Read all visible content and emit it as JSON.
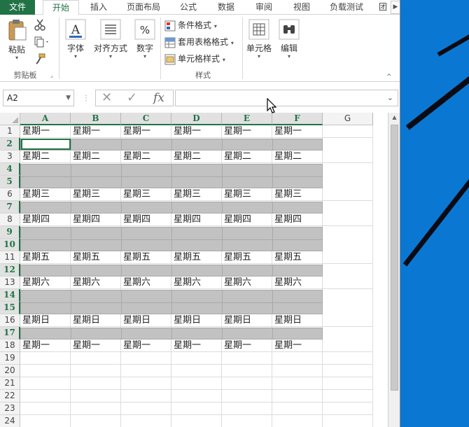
{
  "ribbon": {
    "tabs": [
      {
        "label": "文件",
        "type": "file"
      },
      {
        "label": "开始",
        "type": "active"
      },
      {
        "label": "插入",
        "type": "normal"
      },
      {
        "label": "页面布局",
        "type": "normal"
      },
      {
        "label": "公式",
        "type": "normal"
      },
      {
        "label": "数据",
        "type": "normal"
      },
      {
        "label": "审阅",
        "type": "normal"
      },
      {
        "label": "视图",
        "type": "normal"
      },
      {
        "label": "负载测试",
        "type": "normal"
      },
      {
        "label": "团",
        "type": "normal"
      }
    ],
    "clipboard": {
      "paste_label": "粘贴",
      "group_label": "剪贴板"
    },
    "font": {
      "label": "字体"
    },
    "alignment": {
      "label": "对齐方式"
    },
    "number": {
      "label": "数字"
    },
    "styles": {
      "conditional_label": "条件格式",
      "table_label": "套用表格格式",
      "cell_style_label": "单元格样式",
      "group_label": "样式"
    },
    "cells": {
      "label": "单元格"
    },
    "editing": {
      "label": "编辑"
    }
  },
  "formula_bar": {
    "name_box": "A2",
    "fx_label": "fx",
    "value": ""
  },
  "sheet": {
    "columns": [
      "A",
      "B",
      "C",
      "D",
      "E",
      "F",
      "G"
    ],
    "selected_columns": [
      "A",
      "B",
      "C",
      "D",
      "E",
      "F"
    ],
    "rows": [
      {
        "num": "1",
        "selected": false,
        "cells": [
          "星期一",
          "星期一",
          "星期一",
          "星期一",
          "星期一",
          "星期一"
        ]
      },
      {
        "num": "2",
        "selected": true,
        "cells": []
      },
      {
        "num": "3",
        "selected": false,
        "cells": [
          "星期二",
          "星期二",
          "星期二",
          "星期二",
          "星期二",
          "星期二"
        ]
      },
      {
        "num": "4",
        "selected": true,
        "cells": []
      },
      {
        "num": "5",
        "selected": true,
        "cells": []
      },
      {
        "num": "6",
        "selected": false,
        "cells": [
          "星期三",
          "星期三",
          "星期三",
          "星期三",
          "星期三",
          "星期三"
        ]
      },
      {
        "num": "7",
        "selected": true,
        "cells": []
      },
      {
        "num": "8",
        "selected": false,
        "cells": [
          "星期四",
          "星期四",
          "星期四",
          "星期四",
          "星期四",
          "星期四"
        ]
      },
      {
        "num": "9",
        "selected": true,
        "cells": []
      },
      {
        "num": "10",
        "selected": true,
        "cells": []
      },
      {
        "num": "11",
        "selected": false,
        "cells": [
          "星期五",
          "星期五",
          "星期五",
          "星期五",
          "星期五",
          "星期五"
        ]
      },
      {
        "num": "12",
        "selected": true,
        "cells": []
      },
      {
        "num": "13",
        "selected": false,
        "cells": [
          "星期六",
          "星期六",
          "星期六",
          "星期六",
          "星期六",
          "星期六"
        ]
      },
      {
        "num": "14",
        "selected": true,
        "cells": []
      },
      {
        "num": "15",
        "selected": true,
        "cells": []
      },
      {
        "num": "16",
        "selected": false,
        "cells": [
          "星期日",
          "星期日",
          "星期日",
          "星期日",
          "星期日",
          "星期日"
        ]
      },
      {
        "num": "17",
        "selected": true,
        "cells": []
      },
      {
        "num": "18",
        "selected": false,
        "cells": [
          "星期一",
          "星期一",
          "星期一",
          "星期一",
          "星期一",
          "星期一"
        ]
      },
      {
        "num": "19",
        "selected": false,
        "cells": []
      },
      {
        "num": "20",
        "selected": false,
        "cells": []
      },
      {
        "num": "21",
        "selected": false,
        "cells": []
      },
      {
        "num": "22",
        "selected": false,
        "cells": []
      },
      {
        "num": "23",
        "selected": false,
        "cells": []
      },
      {
        "num": "24",
        "selected": false,
        "cells": []
      }
    ],
    "active_cell": "A2"
  },
  "colors": {
    "excel_green": "#217346",
    "selection_gray": "#c2c2c2",
    "desktop_blue": "#0a78d2"
  }
}
